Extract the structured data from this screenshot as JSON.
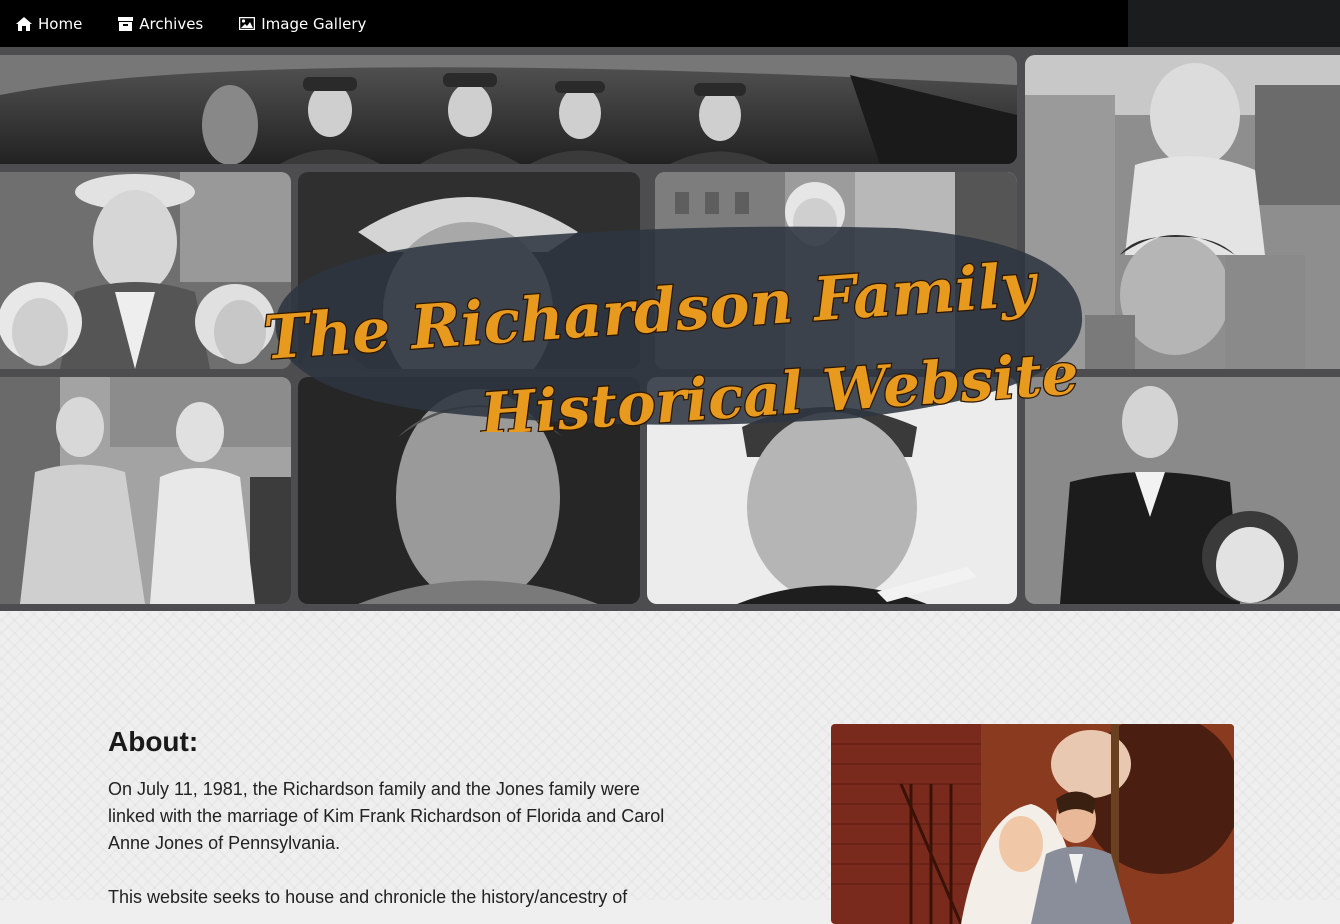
{
  "nav": {
    "items": [
      {
        "label": "Home",
        "icon": "home-icon"
      },
      {
        "label": "Archives",
        "icon": "archive-box-icon"
      },
      {
        "label": "Image Gallery",
        "icon": "image-icon"
      }
    ]
  },
  "hero": {
    "title_line1": "The Richardson Family",
    "title_line2": "Historical Website"
  },
  "about": {
    "heading": "About:",
    "paragraph1": "On July 11, 1981, the Richardson family and the Jones family were linked with the marriage of Kim Frank Richardson of Florida and Carol Anne Jones of Pennsylvania.",
    "paragraph2": "This website seeks to house and chronicle the history/ancestry of"
  },
  "colors": {
    "nav_bg": "#000000",
    "hero_frame": "#4d4d4f",
    "title_gold": "#e89a1e",
    "content_bg": "#efefef"
  }
}
